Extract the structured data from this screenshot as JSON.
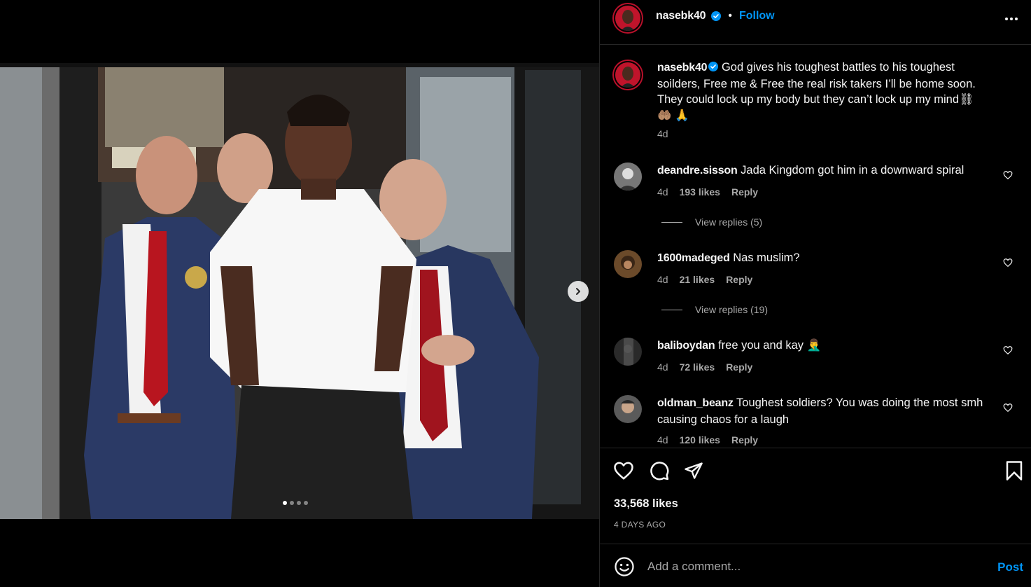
{
  "post": {
    "username": "nasebk40",
    "follow_label": "Follow",
    "separator": "•",
    "more_icon": "more-horizontal-icon",
    "caption": "God gives his toughest battles to his toughest soilders, Free me & Free the real risk takers I’ll be home soon. They could lock up my body but they can’t lock up my mind⛓",
    "caption_emojis": "🤲🏽 🙏",
    "caption_age": "4d",
    "likes": "33,568 likes",
    "date": "4 DAYS AGO",
    "carousel": {
      "count": 4,
      "active_index": 0
    }
  },
  "comments": [
    {
      "user": "deandre.sisson",
      "text": "Jada Kingdom got him in a downward spiral",
      "age": "4d",
      "likes": "193 likes",
      "reply": "Reply",
      "view_replies": "View replies (5)"
    },
    {
      "user": "1600madeged",
      "text": "Nas muslim?",
      "age": "4d",
      "likes": "21 likes",
      "reply": "Reply",
      "view_replies": "View replies (19)"
    },
    {
      "user": "baliboydan",
      "text": "free you and kay 🤦‍♂️",
      "age": "4d",
      "likes": "72 likes",
      "reply": "Reply"
    },
    {
      "user": "oldman_beanz",
      "text": "Toughest soldiers? You was doing the most smh causing chaos for a laugh",
      "age": "4d",
      "likes": "120 likes",
      "reply": "Reply"
    }
  ],
  "composer": {
    "placeholder": "Add a comment...",
    "post_label": "Post"
  },
  "colors": {
    "accent": "#0095f6",
    "background": "#000000",
    "muted": "#a8a8a8",
    "divider": "#262626"
  }
}
